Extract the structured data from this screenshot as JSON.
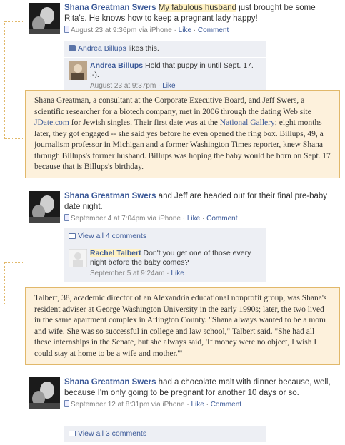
{
  "post1": {
    "author": "Shana Greatman Swers",
    "highlight": "My fabulous husband",
    "text": " just brought be some Rita's. He knows how to keep a pregnant lady happy!",
    "meta_time": "August 23 at 9:36pm via iPhone",
    "like_link": "Like",
    "comment_link": "Comment",
    "likes_name": "Andrea Billups",
    "likes_suffix": " likes this.",
    "comments": [
      {
        "name": "Andrea Billups",
        "text": " Hold that puppy in until Sept. 17. :-).",
        "time": "August 23 at 9:37pm",
        "like": "Like"
      }
    ]
  },
  "box1": {
    "text_a": "Shana Greatman, a consultant at the Corporate Executive Board, and Jeff Swers, a scientific researcher for a biotech company, met in 2006 through the dating Web site ",
    "link_a": "JDate.com",
    "text_b": " for Jewish singles. Their first date was at the ",
    "link_b": "National Gallery",
    "text_c": "; eight months later, they got engaged -- she said yes before he even opened the ring box. Billups, 49, a journalism professor in Michigan and a former Washington Times reporter, knew Shana through Billups's former husband. Billups was hoping the baby would be born on Sept. 17 because that is Billups's birthday."
  },
  "post2": {
    "author": "Shana Greatman Swers",
    "text": " and Jeff are headed out for their final pre-baby date night.",
    "meta_time": "September 4 at 7:04pm via iPhone",
    "like_link": "Like",
    "comment_link": "Comment",
    "view_all": "View all 4 comments",
    "comments": [
      {
        "name": "Rachel Talbert",
        "text": " Don't you get one of those every night before the baby comes?",
        "time": "September 5 at 9:24am",
        "like": "Like"
      }
    ]
  },
  "box2": {
    "text": "Talbert, 38, academic director of an Alexandria educational nonprofit group, was Shana's resident adviser at George Washington University in the early 1990s; later, the two lived in the same apartment complex in Arlington County. \"Shana always wanted to be a mom and wife. She was so successful in college and law school,\" Talbert said. \"She had all these internships in the Senate, but she always said, 'If money were no object, I wish I could stay at home to be a wife and mother.'\""
  },
  "post3": {
    "author": "Shana Greatman Swers",
    "text": " had a chocolate malt with dinner because, well, because I'm only going to be pregnant for another 10 days or so.",
    "meta_time": "September 12 at 8:31pm via iPhone",
    "like_link": "Like",
    "comment_link": "Comment",
    "view_all": "View all 3 comments"
  },
  "colors": {
    "link": "#3b5998",
    "box_bg": "#fdf1dc",
    "box_border": "#e1b86a",
    "highlight": "#fff2c4",
    "ufi_bg": "#edeff4"
  },
  "icons": [
    "phone-icon",
    "like-thumb-icon",
    "comment-bubble-icon"
  ]
}
